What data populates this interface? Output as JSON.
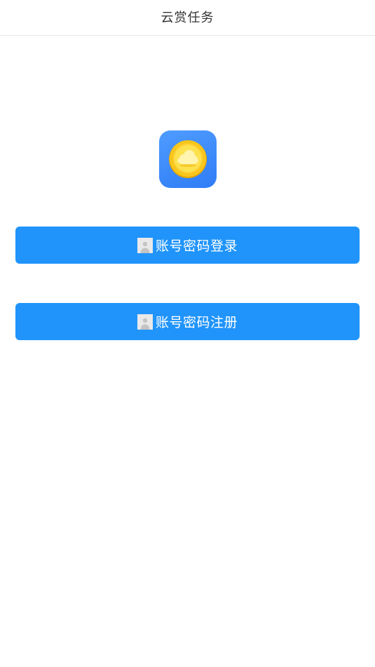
{
  "header": {
    "title": "云赏任务"
  },
  "logo": {
    "icon": "coin-cloud-icon",
    "background_color": "#3a86f8",
    "coin_color": "#f7c520"
  },
  "actions": {
    "login_label": "账号密码登录",
    "register_label": "账号密码注册",
    "button_color": "#2094fb",
    "button_icon": "user-placeholder-icon"
  }
}
